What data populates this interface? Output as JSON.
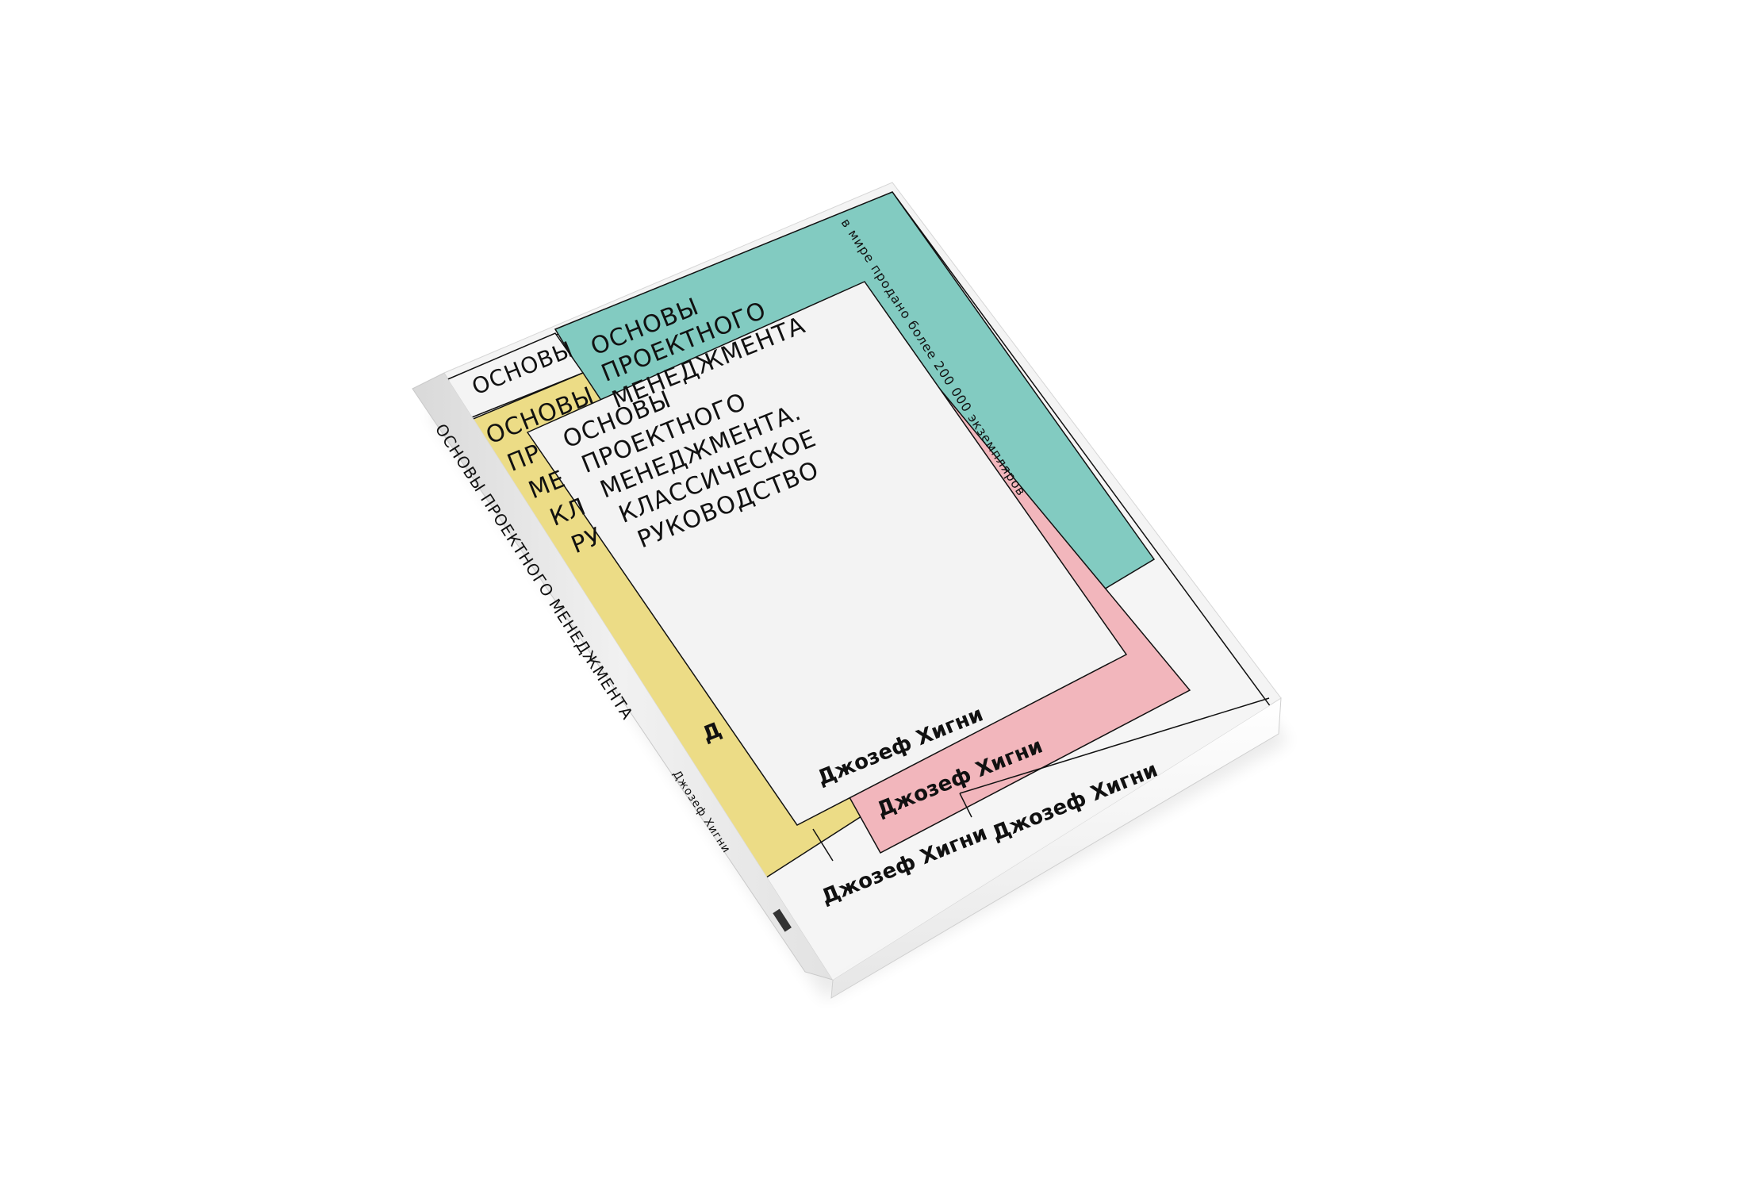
{
  "book": {
    "title_lines": [
      "ОСНОВЫ",
      "ПРОЕКТНОГО",
      "МЕНЕДЖМЕНТА.",
      "КЛАССИЧЕСКОЕ",
      "РУКОВОДСТВО"
    ],
    "author": "Джозеф Хигни",
    "tagline": "в мире продано более 200 000 экземпляров",
    "spine_title": "ОСНОВЫ ПРОЕКТНОГО МЕНЕДЖМЕНТА",
    "spine_author": "Джозеф Хигни",
    "back_title_fragment": "ОСНОВЫ",
    "yellow_fragments": [
      "ОСНОВЫ",
      "ПР",
      "МЕ",
      "КЛ",
      "РУ"
    ],
    "yellow_author_fragment": "Д",
    "green_title_lines": [
      "ОСНОВЫ",
      "ПРОЕКТНОГО",
      "МЕНЕДЖМЕНТА"
    ]
  },
  "colors": {
    "teal": "#82cbc1",
    "yellow": "#ecdc86",
    "pink": "#f2b6bc",
    "cover_white": "#f4f4f4",
    "spine": "#e9e9e9",
    "pages": "#fbfbfb",
    "ink": "#111111"
  }
}
